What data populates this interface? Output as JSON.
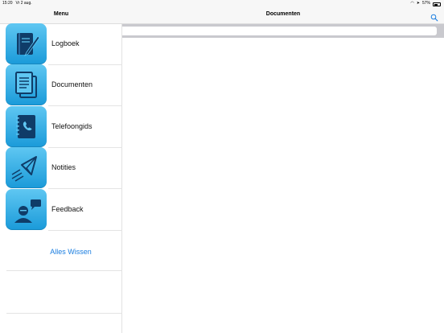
{
  "status": {
    "time": "15:20",
    "date": "Vr 2 aug.",
    "battery": "57%",
    "battery_level": 0.57
  },
  "sidebar": {
    "title": "Menu",
    "items": [
      {
        "label": "Logboek",
        "icon": "notebook-pen-icon"
      },
      {
        "label": "Documenten",
        "icon": "documents-icon"
      },
      {
        "label": "Telefoongids",
        "icon": "phonebook-icon"
      },
      {
        "label": "Notities",
        "icon": "paper-plane-icon"
      },
      {
        "label": "Feedback",
        "icon": "feedback-person-icon"
      }
    ],
    "clear_label": "Alles Wissen"
  },
  "main": {
    "title": "Documenten",
    "search_value": "",
    "search_icon": "search-icon"
  },
  "colors": {
    "accent": "#1b7ee0",
    "icon_top": "#5fc7f2",
    "icon_bottom": "#1a9ad9",
    "icon_dark": "#0f3c68"
  }
}
